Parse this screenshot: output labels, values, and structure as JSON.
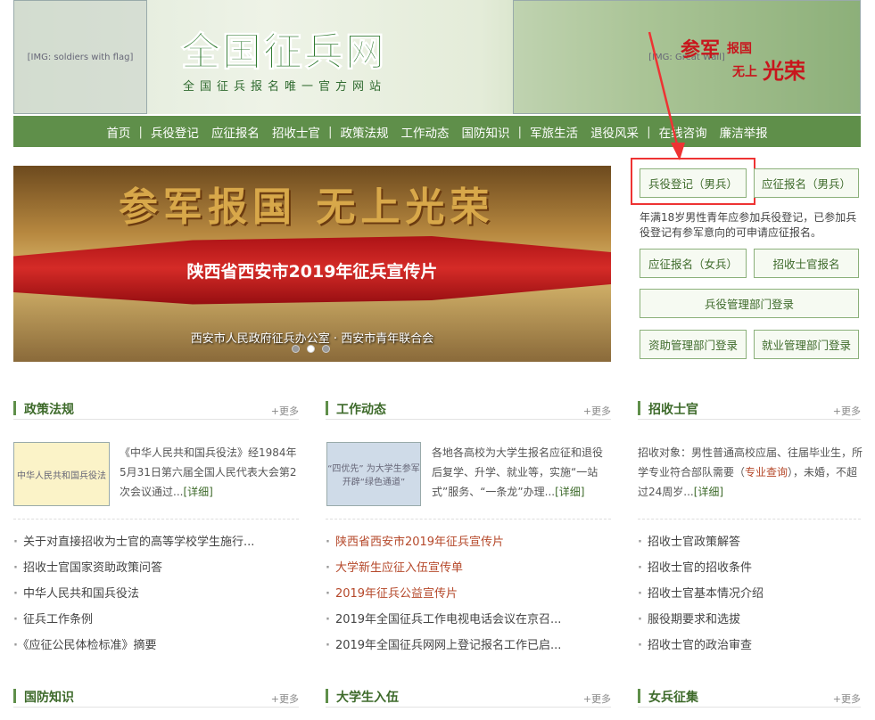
{
  "header": {
    "title": "全国征兵网",
    "subtitle": "全国征兵报名唯一官方网站",
    "slogan": [
      "参军",
      "报国",
      "无上",
      "光荣"
    ]
  },
  "nav": {
    "items": [
      "首页",
      "兵役登记",
      "应征报名",
      "招收士官",
      "政策法规",
      "工作动态",
      "国防知识",
      "军旅生活",
      "退役风采",
      "在线咨询",
      "廉洁举报"
    ],
    "separator": "|"
  },
  "hero": {
    "headline": "参军报国 无上光荣",
    "caption": "陕西省西安市2019年征兵宣传片",
    "footer": "西安市人民政府征兵办公室 · 西安市青年联合会",
    "slide_count": 3,
    "active_slide": 2
  },
  "side": {
    "register_male": "兵役登记（男兵）",
    "apply_male": "应征报名（男兵）",
    "note": "年满18岁男性青年应参加兵役登记，已参加兵役登记有参军意向的可申请应征报名。",
    "apply_female": "应征报名（女兵）",
    "nco_apply": "招收士官报名",
    "dept_login": "兵役管理部门登录",
    "aid_login": "资助管理部门登录",
    "employ_login": "就业管理部门登录"
  },
  "sections": {
    "more_label": "+更多",
    "detail_label": "[详细]",
    "policy": {
      "title": "政策法规",
      "img_text": "中华人民共和国兵役法",
      "intro": "《中华人民共和国兵役法》经1984年5月31日第六届全国人民代表大会第2次会议通过...",
      "items": [
        "关于对直接招收为士官的高等学校学生施行...",
        "招收士官国家资助政策问答",
        "中华人民共和国兵役法",
        "征兵工作条例",
        "《应征公民体检标准》摘要"
      ]
    },
    "news": {
      "title": "工作动态",
      "img_text": "“四优先” 为大学生参军开辟“绿色通道”",
      "intro": "各地各高校为大学生报名应征和退役后复学、升学、就业等，实施“一站式”服务、“一条龙”办理...",
      "items": [
        "陕西省西安市2019年征兵宣传片",
        "大学新生应征入伍宣传单",
        "2019年征兵公益宣传片",
        "2019年全国征兵工作电视电话会议在京召...",
        "2019年全国征兵网网上登记报名工作已启..."
      ]
    },
    "nco": {
      "title": "招收士官",
      "intro_a": "招收对象：男性普通高校应届、往届毕业生，所学专业符合部队需要（",
      "intro_link": "专业查询",
      "intro_b": "），未婚，不超过24周岁...",
      "items": [
        "招收士官政策解答",
        "招收士官的招收条件",
        "招收士官基本情况介绍",
        "服役期要求和选拔",
        "招收士官的政治审查"
      ]
    },
    "bottom": [
      "国防知识",
      "大学生入伍",
      "女兵征集"
    ]
  },
  "colors": {
    "primary": "#5f8f4a",
    "highlight": "#e33333",
    "link_red": "#b5482a"
  }
}
